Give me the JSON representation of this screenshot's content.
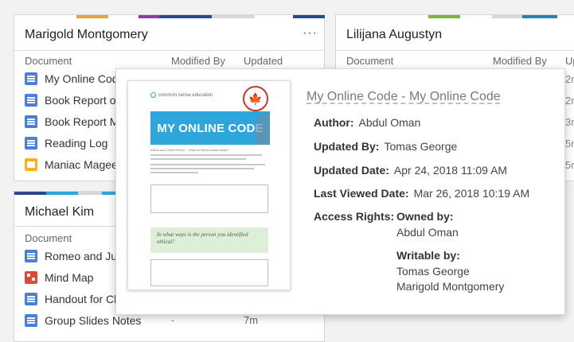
{
  "cards": {
    "left_top": {
      "title": "Marigold Montgomery",
      "menu": "···",
      "headers": {
        "document": "Document",
        "modified_by": "Modified By",
        "updated": "Updated"
      },
      "rows": [
        {
          "name": "My Online Code",
          "type": "doc"
        },
        {
          "name": "Book Report or Essay",
          "type": "doc"
        },
        {
          "name": "Book Report Mini",
          "type": "doc"
        },
        {
          "name": "Reading Log",
          "type": "doc"
        },
        {
          "name": "Maniac Magee",
          "type": "slides"
        }
      ],
      "strip_colors": [
        "#e8a33d",
        "#8c3fa0",
        "#2a4a8c",
        "#d8d8d8",
        "#2a4a8c"
      ]
    },
    "right_top": {
      "title": "Lilijana Augustyn",
      "headers": {
        "document": "Document",
        "modified_by": "Modified By",
        "updated": "Up"
      },
      "updated_fragments": [
        "2r",
        "2r",
        "3r",
        "5r",
        "5r"
      ],
      "strip_colors": [
        "#7cb342",
        "#2a7fb0",
        "#d8d8d8"
      ]
    },
    "left_bottom": {
      "title": "Michael Kim",
      "headers": {
        "document": "Document"
      },
      "rows": [
        {
          "name": "Romeo and Juliet",
          "type": "doc"
        },
        {
          "name": "Mind Map",
          "type": "map"
        },
        {
          "name": "Handout for Class",
          "type": "doc"
        },
        {
          "name": "Group Slides Notes",
          "type": "doc",
          "modified_by": "-",
          "updated": "7m"
        }
      ],
      "strip_colors": [
        "#2a4a8c",
        "#2ea6dc",
        "#d8d8d8",
        "#2ea6dc"
      ]
    }
  },
  "popover": {
    "title": "My Online Code - My Online Code",
    "author_label": "Author:",
    "author": "Abdul Oman",
    "updated_by_label": "Updated By:",
    "updated_by": "Tomas George",
    "updated_date_label": "Updated Date:",
    "updated_date": "Apr 24, 2018 11:09 AM",
    "last_viewed_label": "Last Viewed Date:",
    "last_viewed": "Mar 26, 2018 10:19 AM",
    "access_label": "Access Rights:",
    "owned_by_label": "Owned by:",
    "owned_by": "Abdul Oman",
    "writable_by_label": "Writable by:",
    "writable_by": [
      "Tomas George",
      "Marigold Montgomery"
    ],
    "thumbnail": {
      "logo_text": "common sense education",
      "banner": "MY ONLINE CODE",
      "question": "In what ways is the person you identified ethical?",
      "intro": "Ethics and Online Ethics... What do these words mean?"
    }
  }
}
